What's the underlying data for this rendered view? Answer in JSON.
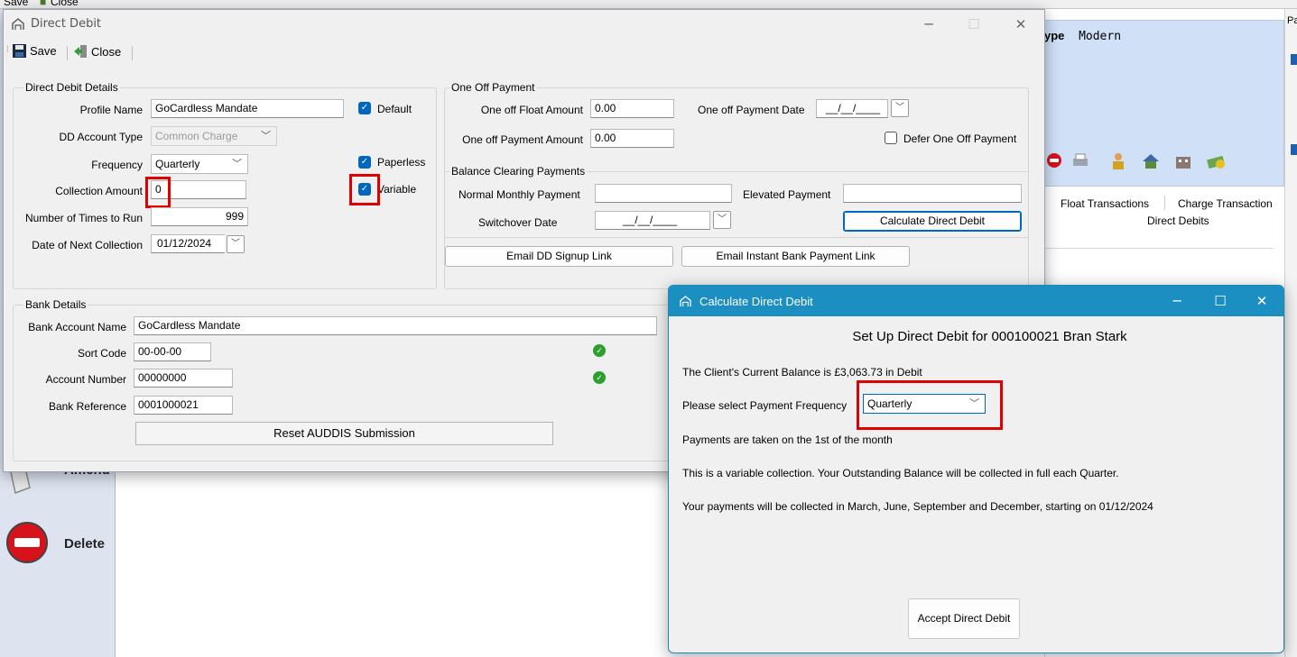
{
  "background": {
    "top_bar": {
      "save": "Save",
      "close": "Close"
    },
    "type_label": "ype",
    "type_value": "Modern",
    "pa_fragment": "Pa",
    "tabs": [
      "Float Transactions",
      "Charge Transaction"
    ],
    "active_tab_content": "Direct Debits",
    "nav": [
      {
        "label": "Amend"
      },
      {
        "label": "Delete"
      }
    ]
  },
  "dd_window": {
    "title": "Direct Debit",
    "toolbar": {
      "save": "Save",
      "close": "Close"
    },
    "dd_details": {
      "group_label": "Direct Debit Details",
      "profile_name_label": "Profile Name",
      "profile_name": "GoCardless Mandate",
      "default_label": "Default",
      "default_checked": true,
      "account_type_label": "DD Account Type",
      "account_type": "Common Charge",
      "frequency_label": "Frequency",
      "frequency": "Quarterly",
      "paperless_label": "Paperless",
      "paperless_checked": true,
      "collection_amount_label": "Collection Amount",
      "collection_amount": "0",
      "variable_label": "Variable",
      "variable_checked": true,
      "times_to_run_label": "Number of Times to Run",
      "times_to_run": "999",
      "next_collection_label": "Date of Next Collection",
      "next_collection": "01/12/2024"
    },
    "one_off": {
      "group_label": "One Off Payment",
      "float_amount_label": "One off Float Amount",
      "float_amount": "0.00",
      "payment_date_label": "One off Payment Date",
      "payment_date": "__/__/____",
      "payment_amount_label": "One off Payment Amount",
      "payment_amount": "0.00",
      "defer_label": "Defer One Off Payment",
      "defer_checked": false
    },
    "balance_clearing": {
      "group_label": "Balance Clearing Payments",
      "normal_monthly_label": "Normal Monthly Payment",
      "normal_monthly": "",
      "elevated_label": "Elevated Payment",
      "elevated": "",
      "switchover_label": "Switchover Date",
      "switchover": "__/__/____",
      "calculate_button": "Calculate Direct Debit"
    },
    "email_signup_button": "Email DD Signup Link",
    "email_instant_button": "Email Instant Bank Payment Link",
    "bank": {
      "group_label": "Bank Details",
      "account_name_label": "Bank Account Name",
      "account_name": "GoCardless Mandate",
      "sort_code_label": "Sort Code",
      "sort_code": "00-00-00",
      "account_number_label": "Account Number",
      "account_number": "00000000",
      "reference_label": "Bank Reference",
      "reference": "0001000021",
      "reset_button": "Reset AUDDIS Submission"
    }
  },
  "calc_window": {
    "title": "Calculate Direct Debit",
    "heading": "Set Up Direct Debit for 000100021 Bran Stark",
    "balance_line": "The Client's Current Balance is £3,063.73 in Debit",
    "frequency_label": "Please select Payment Frequency",
    "frequency_value": "Quarterly",
    "line_first": "Payments are taken on the 1st of the month",
    "line_variable": "This is a variable collection. Your Outstanding Balance will be collected in full each Quarter.",
    "line_schedule": "Your payments will be collected in March, June, September and December, starting on 01/12/2024",
    "accept_button": "Accept Direct Debit"
  },
  "colors": {
    "accent": "#0067c0",
    "calc_title_bar": "#1b8fc2",
    "highlight": "#e00000"
  },
  "icons": [
    "app-logo-icon",
    "save-disk-icon",
    "close-door-icon",
    "chevron-down-icon",
    "checkmark-icon",
    "green-tick-icon",
    "delete-stop-icon",
    "amend-pencil-icon"
  ]
}
